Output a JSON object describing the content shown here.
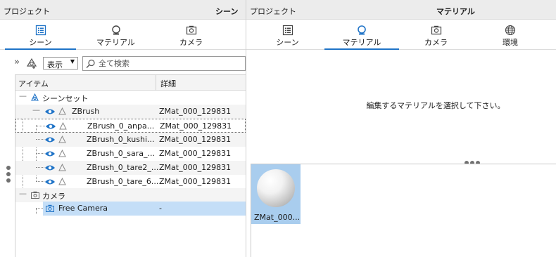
{
  "left": {
    "title_left": "プロジェクト",
    "title_right": "シーン",
    "tabs": [
      {
        "label": "シーン",
        "icon": "list-icon",
        "active": true
      },
      {
        "label": "マテリアル",
        "icon": "material-icon",
        "active": false
      },
      {
        "label": "カメラ",
        "icon": "camera-icon",
        "active": false
      }
    ],
    "toolbar": {
      "expand_glyph": "»",
      "display_label": "表示",
      "search_placeholder": "全て検索"
    },
    "tree": {
      "col_item": "アイテム",
      "col_detail": "詳細",
      "collapse_glyph": "—",
      "rows": [
        {
          "name": "シーンセット",
          "detail": ""
        },
        {
          "name": "ZBrush",
          "detail": "ZMat_000_129831"
        },
        {
          "name": "ZBrush_0_anpa...",
          "detail": "ZMat_000_129831"
        },
        {
          "name": "ZBrush_0_kushi...",
          "detail": "ZMat_000_129831"
        },
        {
          "name": "ZBrush_0_sara_...",
          "detail": "ZMat_000_129831"
        },
        {
          "name": "ZBrush_0_tare2_...",
          "detail": "ZMat_000_129831"
        },
        {
          "name": "ZBrush_0_tare_6...",
          "detail": "ZMat_000_129831"
        },
        {
          "name": "カメラ",
          "detail": ""
        },
        {
          "name": "Free Camera",
          "detail": "-"
        }
      ]
    }
  },
  "right": {
    "title_left": "プロジェクト",
    "title_right": "マテリアル",
    "tabs": [
      {
        "label": "シーン",
        "icon": "list-icon",
        "active": false
      },
      {
        "label": "マテリアル",
        "icon": "material-icon",
        "active": true
      },
      {
        "label": "カメラ",
        "icon": "camera-icon",
        "active": false
      },
      {
        "label": "環境",
        "icon": "globe-icon",
        "active": false
      }
    ],
    "message": "編集するマテリアルを選択して下さい。",
    "materials": [
      {
        "name": "ZMat_000..."
      }
    ]
  },
  "colors": {
    "accent": "#1f73c7",
    "selected_row": "#c4def7",
    "swatch_bg": "#a9cdee",
    "titlebar": "#ececec"
  }
}
